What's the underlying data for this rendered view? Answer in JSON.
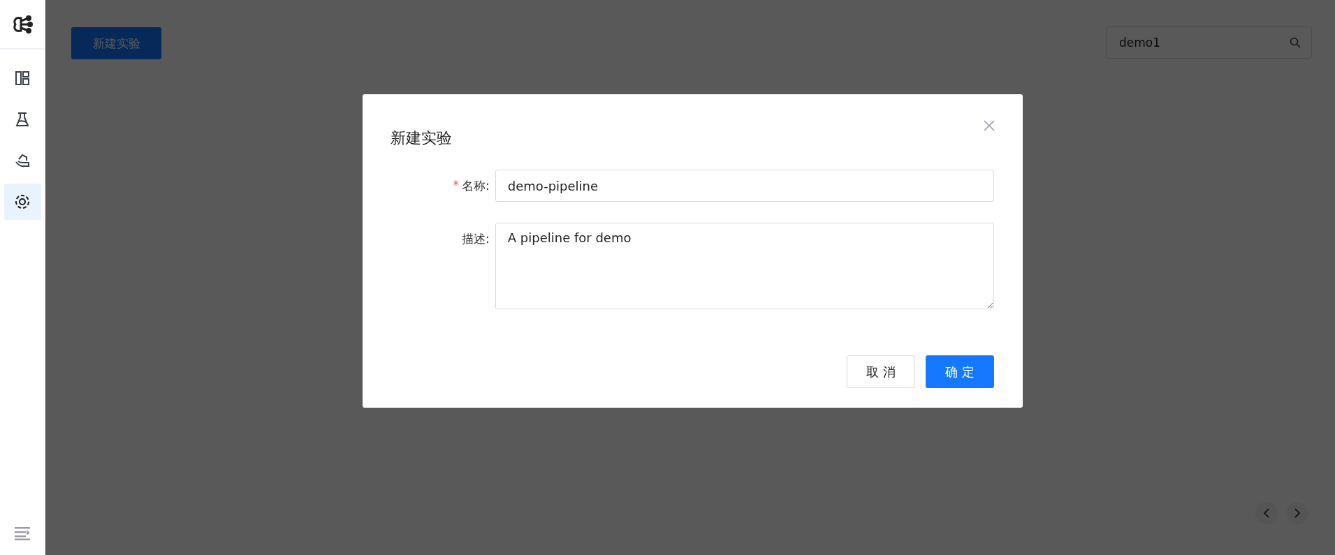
{
  "sidebar": {
    "items": [
      {
        "kind": "layout",
        "selected": false
      },
      {
        "kind": "flask",
        "selected": false
      },
      {
        "kind": "hand",
        "selected": false
      },
      {
        "kind": "target",
        "selected": true
      }
    ]
  },
  "toolbar": {
    "new_button": "新建实验",
    "search": {
      "value": "demo1"
    }
  },
  "modal": {
    "title": "新建实验",
    "fields": [
      {
        "kind": "input",
        "required_mark": "*",
        "label": "名称:",
        "value": "demo-pipeline"
      },
      {
        "kind": "textarea",
        "label": "描述:",
        "value": "A pipeline for demo"
      }
    ],
    "buttons": [
      {
        "kind": "default",
        "label": "取 消"
      },
      {
        "kind": "primary",
        "label": "确 定"
      }
    ]
  }
}
